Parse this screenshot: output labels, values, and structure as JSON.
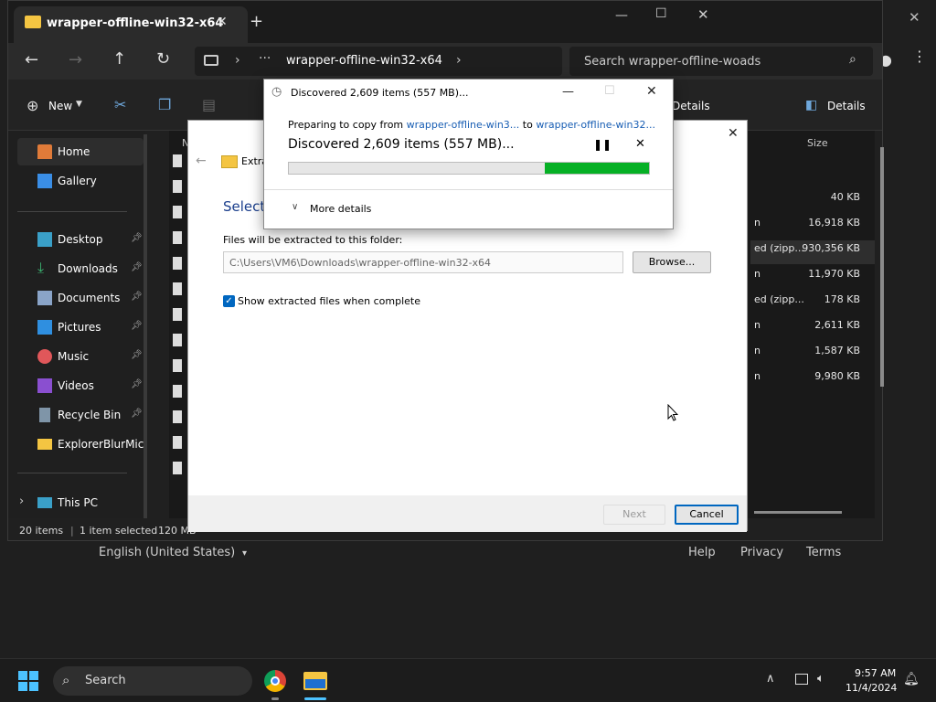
{
  "setup_page": {
    "language": "English (United States)",
    "help": "Help",
    "privacy": "Privacy",
    "terms": "Terms"
  },
  "explorer": {
    "tab_title": "wrapper-offline-win32-x64",
    "address": "wrapper-offline-win32-x64",
    "search_placeholder": "Search wrapper-offline-woads",
    "toolbar": {
      "new_label": "New",
      "details_label": "Details",
      "details_label_2": "Details"
    },
    "nav": [
      {
        "label": "Home"
      },
      {
        "label": "Gallery"
      },
      {
        "label": "Desktop"
      },
      {
        "label": "Downloads"
      },
      {
        "label": "Documents"
      },
      {
        "label": "Pictures"
      },
      {
        "label": "Music"
      },
      {
        "label": "Videos"
      },
      {
        "label": "Recycle Bin"
      },
      {
        "label": "ExplorerBlurMic"
      },
      {
        "label": "This PC"
      }
    ],
    "columns": {
      "name": "N",
      "size": "Size"
    },
    "rows": [
      {
        "type": "",
        "size": "40 KB"
      },
      {
        "type": "n",
        "size": "16,918 KB"
      },
      {
        "type": "ed (zipp...",
        "size": "930,356 KB"
      },
      {
        "type": "n",
        "size": "11,970 KB"
      },
      {
        "type": "ed (zipp...",
        "size": "178 KB"
      },
      {
        "type": "n",
        "size": "2,611 KB"
      },
      {
        "type": "n",
        "size": "1,587 KB"
      },
      {
        "type": "n",
        "size": "9,980 KB"
      }
    ],
    "status": {
      "items": "20 items",
      "selected": "1 item selected",
      "selected_size": "120 MB"
    }
  },
  "extract_dialog": {
    "crumb": "Extra",
    "heading": "Select",
    "folder_label": "Files will be extracted to this folder:",
    "folder_path": "C:\\Users\\VM6\\Downloads\\wrapper-offline-win32-x64",
    "browse": "Browse...",
    "show_files": "Show extracted files when complete",
    "next": "Next",
    "cancel": "Cancel"
  },
  "copy_dialog": {
    "title": "Discovered 2,609 items (557 MB)...",
    "preparing_prefix": "Preparing to copy from ",
    "from": "wrapper-offline-win3...",
    "to_word": " to ",
    "to": "wrapper-offline-win32...",
    "status": "Discovered 2,609 items (557 MB)...",
    "more_details": "More details",
    "progress": 0.29
  },
  "taskbar": {
    "search": "Search",
    "time": "9:57 AM",
    "date": "11/4/2024"
  },
  "colors": {
    "accent": "#0067c0",
    "progress": "#06b025"
  }
}
